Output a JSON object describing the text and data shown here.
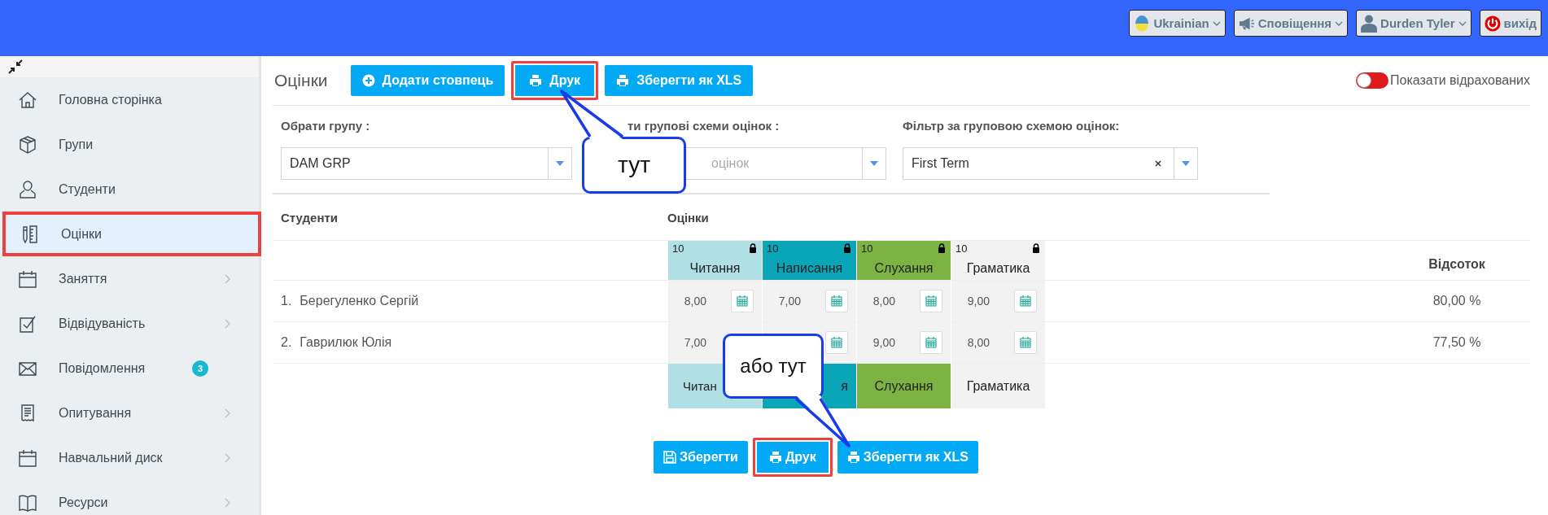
{
  "topbar": {
    "items": [
      {
        "kind": "flag",
        "label": "Ukrainian",
        "dropdown": true
      },
      {
        "kind": "megaphone",
        "label": "Сповіщення",
        "dropdown": true
      },
      {
        "kind": "user",
        "label": "Durden Tyler",
        "dropdown": true
      },
      {
        "kind": "power",
        "label": "вихід",
        "dropdown": false
      }
    ]
  },
  "sidebar": {
    "items": [
      {
        "kind": "home",
        "label": "Головна сторінка",
        "submenu": false,
        "selected": false,
        "highlighted": false
      },
      {
        "kind": "box",
        "label": "Групи",
        "submenu": false,
        "selected": false,
        "highlighted": false
      },
      {
        "kind": "user",
        "label": "Студенти",
        "submenu": false,
        "selected": false,
        "highlighted": false
      },
      {
        "kind": "ruler",
        "label": "Оцінки",
        "submenu": false,
        "selected": true,
        "highlighted": true
      },
      {
        "kind": "calendar",
        "label": "Заняття",
        "submenu": true,
        "selected": false,
        "highlighted": false
      },
      {
        "kind": "check",
        "label": "Відвідуваність",
        "submenu": true,
        "selected": false,
        "highlighted": false
      },
      {
        "kind": "mail",
        "label": "Повідомлення",
        "submenu": false,
        "badge": "3",
        "selected": false,
        "highlighted": false
      },
      {
        "kind": "receipt",
        "label": "Опитування",
        "submenu": true,
        "selected": false,
        "highlighted": false
      },
      {
        "kind": "calendar",
        "label": "Навчальний диск",
        "submenu": true,
        "selected": false,
        "highlighted": false
      },
      {
        "kind": "book",
        "label": "Ресурси",
        "submenu": true,
        "selected": false,
        "highlighted": false
      }
    ]
  },
  "page": {
    "title": "Оцінки",
    "toolbar": [
      {
        "kind": "plus",
        "label": "Додати стовпець",
        "highlighted": false
      },
      {
        "kind": "print",
        "label": "Друк",
        "highlighted": true
      },
      {
        "kind": "print",
        "label": "Зберегти як XLS",
        "highlighted": false
      }
    ],
    "toggle": {
      "label": "Показати відрахованих",
      "on": false
    }
  },
  "filters": [
    {
      "label": "Обрати групу :",
      "value": "DAM GRP",
      "clearable": false
    },
    {
      "label": "ти групові схеми оцінок :",
      "placeholder": "оцінок",
      "clearable": false
    },
    {
      "label": "Фільтр за груповою схемою оцінок:",
      "value": "First Term",
      "clearable": true
    }
  ],
  "table": {
    "students_header": "Студенти",
    "grades_header": "Оцінки",
    "percent_header": "Відсоток",
    "columns": [
      {
        "max": "10",
        "name": "Читання",
        "footer": "Читан",
        "color": "#b0e0e6",
        "locked": true
      },
      {
        "max": "10",
        "name": "Написання",
        "footer": "я",
        "color": "#0ba5b8",
        "locked": true
      },
      {
        "max": "10",
        "name": "Слухання",
        "footer": "Слухання",
        "color": "#7cb342",
        "locked": true
      },
      {
        "max": "10",
        "name": "Граматика",
        "footer": "Граматика",
        "color": "#f2f2f2",
        "locked": true
      }
    ],
    "rows": [
      {
        "number": "1.",
        "name": "Берегуленко Сергій",
        "grades": [
          {
            "kind": "grade",
            "value": "8,00"
          },
          {
            "kind": "grade",
            "value": "7,00"
          },
          {
            "kind": "grade",
            "value": "8,00"
          },
          {
            "kind": "grade",
            "value": "9,00"
          }
        ],
        "percent": "80,00 %"
      },
      {
        "number": "2.",
        "name": "Гаврилюк Юлія",
        "grades": [
          {
            "kind": "value_only",
            "value": "7,00"
          },
          {
            "kind": "calendar_only"
          },
          {
            "kind": "grade",
            "value": "9,00"
          },
          {
            "kind": "grade",
            "value": "8,00"
          }
        ],
        "percent": "77,50 %"
      }
    ]
  },
  "bottom_buttons": [
    {
      "kind": "save",
      "label": "Зберегти",
      "highlighted": false
    },
    {
      "kind": "print",
      "label": "Друк",
      "highlighted": true
    },
    {
      "kind": "print",
      "label": "Зберегти як XLS",
      "highlighted": false
    }
  ],
  "callouts": [
    {
      "text": "тут",
      "kind": "up"
    },
    {
      "text": "або тут",
      "kind": "down"
    }
  ]
}
